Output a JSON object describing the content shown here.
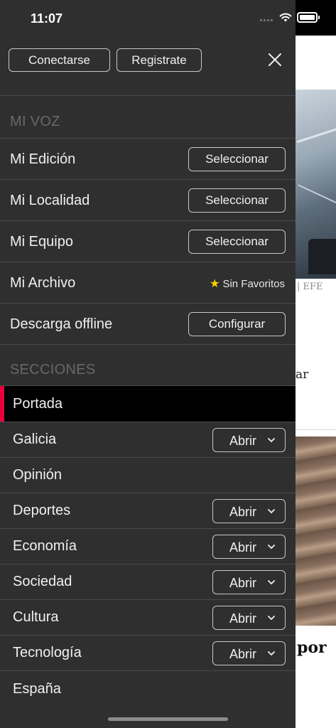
{
  "status": {
    "time": "11:07"
  },
  "header": {
    "login_label": "Conectarse",
    "register_label": "Registrate",
    "close_icon": "close-icon"
  },
  "mi_voz": {
    "title": "MI VOZ",
    "items": [
      {
        "label": "Mi Edición",
        "action": "Seleccionar"
      },
      {
        "label": "Mi Localidad",
        "action": "Seleccionar"
      },
      {
        "label": "Mi Equipo",
        "action": "Seleccionar"
      },
      {
        "label": "Mi Archivo",
        "status": "Sin Favoritos"
      },
      {
        "label": "Descarga offline",
        "action": "Configurar"
      }
    ]
  },
  "secciones": {
    "title": "SECCIONES",
    "items": [
      {
        "label": "Portada",
        "active": true
      },
      {
        "label": "Galicia",
        "action": "Abrir"
      },
      {
        "label": "Opinión"
      },
      {
        "label": "Deportes",
        "action": "Abrir"
      },
      {
        "label": "Economía",
        "action": "Abrir"
      },
      {
        "label": "Sociedad",
        "action": "Abrir"
      },
      {
        "label": "Cultura",
        "action": "Abrir"
      },
      {
        "label": "Tecnología",
        "action": "Abrir"
      },
      {
        "label": "España"
      }
    ]
  },
  "background_article": {
    "photo_credit": "| EFE",
    "text_fragment_1": "ar",
    "text_fragment_2": "por"
  },
  "colors": {
    "drawer_bg": "#2f2f2f",
    "active_bg": "#000000",
    "accent": "#e8003d",
    "star": "#ffd400"
  }
}
